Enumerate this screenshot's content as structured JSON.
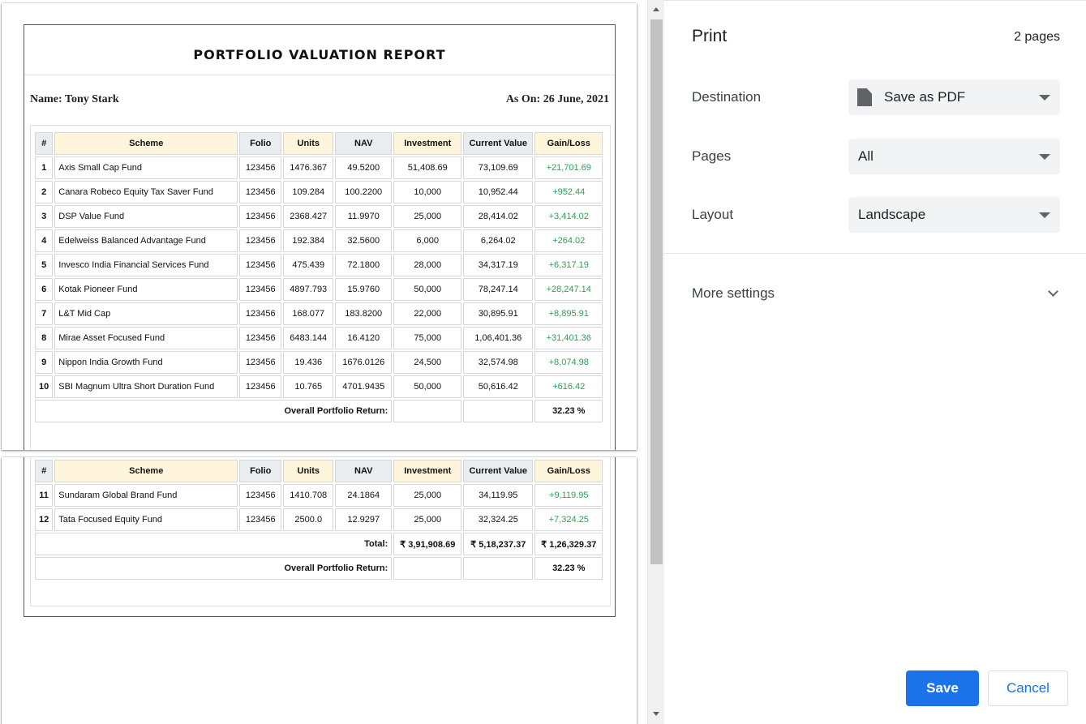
{
  "report": {
    "title": "PORTFOLIO VALUATION REPORT",
    "name_label": "Name: Tony Stark",
    "date_label": "As On: 26 June, 2021"
  },
  "table": {
    "headers": [
      "#",
      "Scheme",
      "Folio",
      "Units",
      "NAV",
      "Investment",
      "Current Value",
      "Gain/Loss"
    ],
    "rows": [
      {
        "num": "1",
        "scheme": "Axis Small Cap Fund",
        "folio": "123456",
        "units": "1476.367",
        "nav": "49.5200",
        "investment": "51,408.69",
        "current": "73,109.69",
        "gain": "+21,701.69"
      },
      {
        "num": "2",
        "scheme": "Canara Robeco Equity Tax Saver Fund",
        "folio": "123456",
        "units": "109.284",
        "nav": "100.2200",
        "investment": "10,000",
        "current": "10,952.44",
        "gain": "+952.44"
      },
      {
        "num": "3",
        "scheme": "DSP Value Fund",
        "folio": "123456",
        "units": "2368.427",
        "nav": "11.9970",
        "investment": "25,000",
        "current": "28,414.02",
        "gain": "+3,414.02"
      },
      {
        "num": "4",
        "scheme": "Edelweiss Balanced Advantage Fund",
        "folio": "123456",
        "units": "192.384",
        "nav": "32.5600",
        "investment": "6,000",
        "current": "6,264.02",
        "gain": "+264.02"
      },
      {
        "num": "5",
        "scheme": "Invesco India Financial Services Fund",
        "folio": "123456",
        "units": "475.439",
        "nav": "72.1800",
        "investment": "28,000",
        "current": "34,317.19",
        "gain": "+6,317.19"
      },
      {
        "num": "6",
        "scheme": "Kotak Pioneer Fund",
        "folio": "123456",
        "units": "4897.793",
        "nav": "15.9760",
        "investment": "50,000",
        "current": "78,247.14",
        "gain": "+28,247.14"
      },
      {
        "num": "7",
        "scheme": "L&T Mid Cap",
        "folio": "123456",
        "units": "168.077",
        "nav": "183.8200",
        "investment": "22,000",
        "current": "30,895.91",
        "gain": "+8,895.91"
      },
      {
        "num": "8",
        "scheme": "Mirae Asset Focused Fund",
        "folio": "123456",
        "units": "6483.144",
        "nav": "16.4120",
        "investment": "75,000",
        "current": "1,06,401.36",
        "gain": "+31,401.36"
      },
      {
        "num": "9",
        "scheme": "Nippon India Growth Fund",
        "folio": "123456",
        "units": "19.436",
        "nav": "1676.0126",
        "investment": "24,500",
        "current": "32,574.98",
        "gain": "+8,074.98"
      },
      {
        "num": "10",
        "scheme": "SBI Magnum Ultra Short Duration Fund",
        "folio": "123456",
        "units": "10.765",
        "nav": "4701.9435",
        "investment": "50,000",
        "current": "50,616.42",
        "gain": "+616.42"
      },
      {
        "num": "11",
        "scheme": "Sundaram Global Brand Fund",
        "folio": "123456",
        "units": "1410.708",
        "nav": "24.1864",
        "investment": "25,000",
        "current": "34,119.95",
        "gain": "+9,119.95"
      },
      {
        "num": "12",
        "scheme": "Tata Focused Equity Fund",
        "folio": "123456",
        "units": "2500.0",
        "nav": "12.9297",
        "investment": "25,000",
        "current": "32,324.25",
        "gain": "+7,324.25"
      }
    ],
    "return_label": "Overall Portfolio Return:",
    "return_value": "32.23 %",
    "total_label": "Total:",
    "total_investment": "₹ 3,91,908.69",
    "total_current": "₹ 5,18,237.37",
    "total_gain": "₹ 1,26,329.37"
  },
  "print_panel": {
    "title": "Print",
    "page_count": "2 pages",
    "destination_label": "Destination",
    "destination_value": "Save as PDF",
    "pages_label": "Pages",
    "pages_value": "All",
    "layout_label": "Layout",
    "layout_value": "Landscape",
    "more_settings_label": "More settings",
    "save_label": "Save",
    "cancel_label": "Cancel"
  },
  "colors": {
    "accent": "#1a73e8",
    "gain_green": "#2e9e55",
    "header_highlight": "#fff5dc",
    "header_gray": "#e9edf0"
  },
  "icons": [
    "document-icon",
    "dropdown-caret-icon",
    "chevron-down-icon",
    "scroll-up-arrow-icon",
    "scroll-down-arrow-icon"
  ]
}
